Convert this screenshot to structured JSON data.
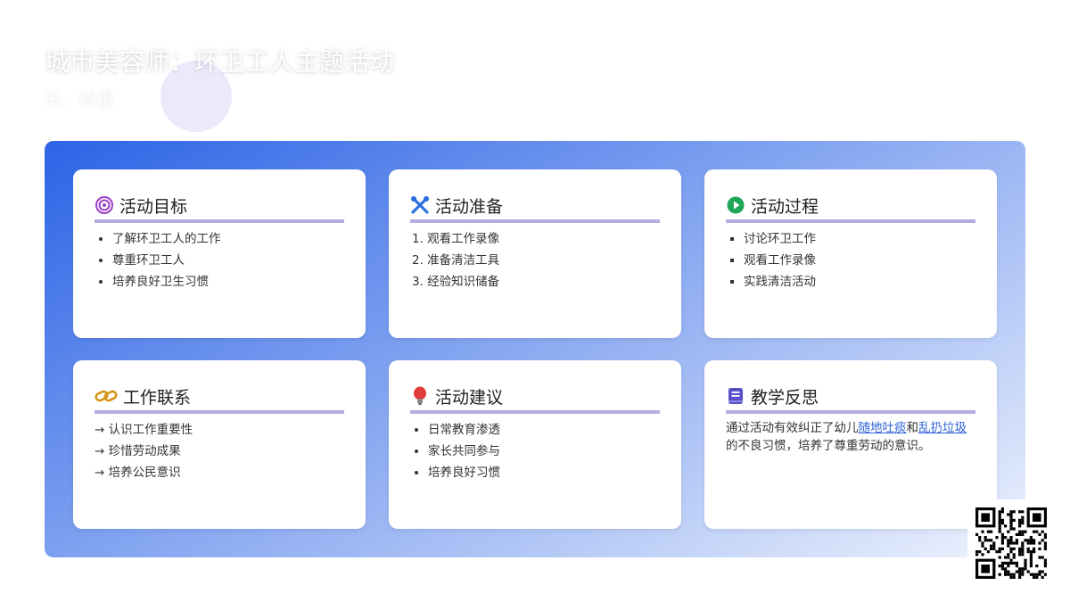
{
  "header": {
    "title": "城市美容师：环卫工人主题活动",
    "subtitle": "识，尊重"
  },
  "cards": {
    "goals": {
      "title": "活动目标",
      "icon": "target-icon",
      "items": [
        "了解环卫工人的工作",
        "尊重环卫工人",
        "培养良好卫生习惯"
      ]
    },
    "prep": {
      "title": "活动准备",
      "icon": "tools-icon",
      "items": [
        "1. 观看工作录像",
        "2. 准备清洁工具",
        "3. 经验知识储备"
      ]
    },
    "process": {
      "title": "活动过程",
      "icon": "play-icon",
      "items": [
        "讨论环卫工作",
        "观看工作录像",
        "实践清洁活动"
      ]
    },
    "links": {
      "title": "工作联系",
      "icon": "chain-link-icon",
      "items": [
        "→ 认识工作重要性",
        "→ 珍惜劳动成果",
        "→ 培养公民意识"
      ]
    },
    "suggest": {
      "title": "活动建议",
      "icon": "lightbulb-icon",
      "items": [
        "日常教育渗透",
        "家长共同参与",
        "培养良好习惯"
      ]
    },
    "reflect": {
      "title": "教学反思",
      "icon": "book-icon",
      "text_1": "通过活动有效纠正了幼儿",
      "link_1": "随地吐痰",
      "text_2": "和",
      "link_2": "乱扔垃圾",
      "text_3": "的不良习惯，培养了尊重劳动的意识。"
    }
  },
  "colors": {
    "panel_gradient_start": "#2c64e6",
    "panel_gradient_end": "#eef3fd",
    "card_underline": "#b6acdf",
    "link": "#2f63d6"
  }
}
